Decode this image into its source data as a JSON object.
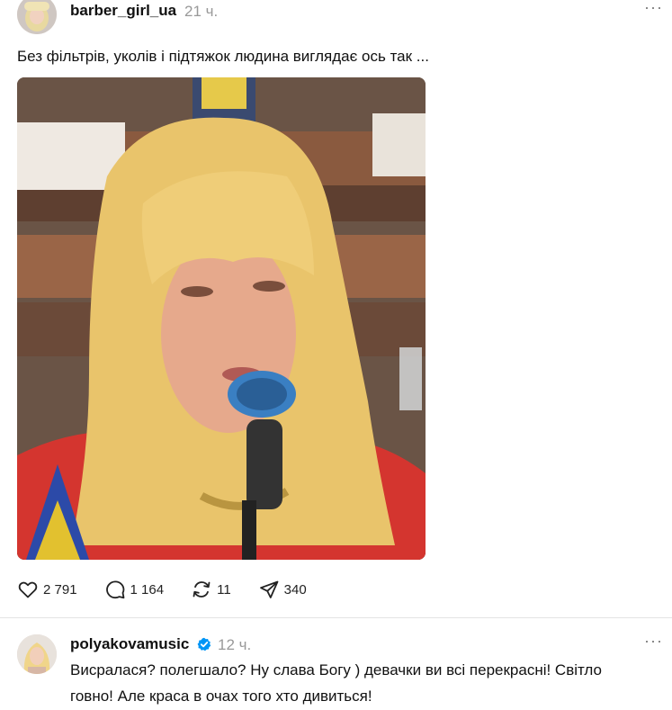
{
  "post": {
    "username": "barber_girl_ua",
    "timestamp": "21 ч.",
    "caption": "Без фільтрів, уколів і підтяжок людина виглядає ось так ...",
    "image_icon": "photo-of-blonde-woman-at-microphone",
    "actions": {
      "like_count": "2 791",
      "comment_count": "1 164",
      "repost_count": "11",
      "share_count": "340"
    },
    "icons": {
      "like": "heart-icon",
      "comment": "speech-bubble-icon",
      "repost": "repost-arrows-icon",
      "share": "send-icon",
      "more": "more-dots-icon"
    }
  },
  "reply": {
    "username": "polyakovamusic",
    "timestamp": "12 ч.",
    "verified": true,
    "text_line1": "Висралася? полегшало? Ну слава Богу ) девачки ви всі перекрасні! Світло",
    "text_line2": "говно! Але краса в очах того хто дивиться!"
  },
  "colors": {
    "verified_badge": "#0095f6",
    "muted_text": "#999999"
  }
}
